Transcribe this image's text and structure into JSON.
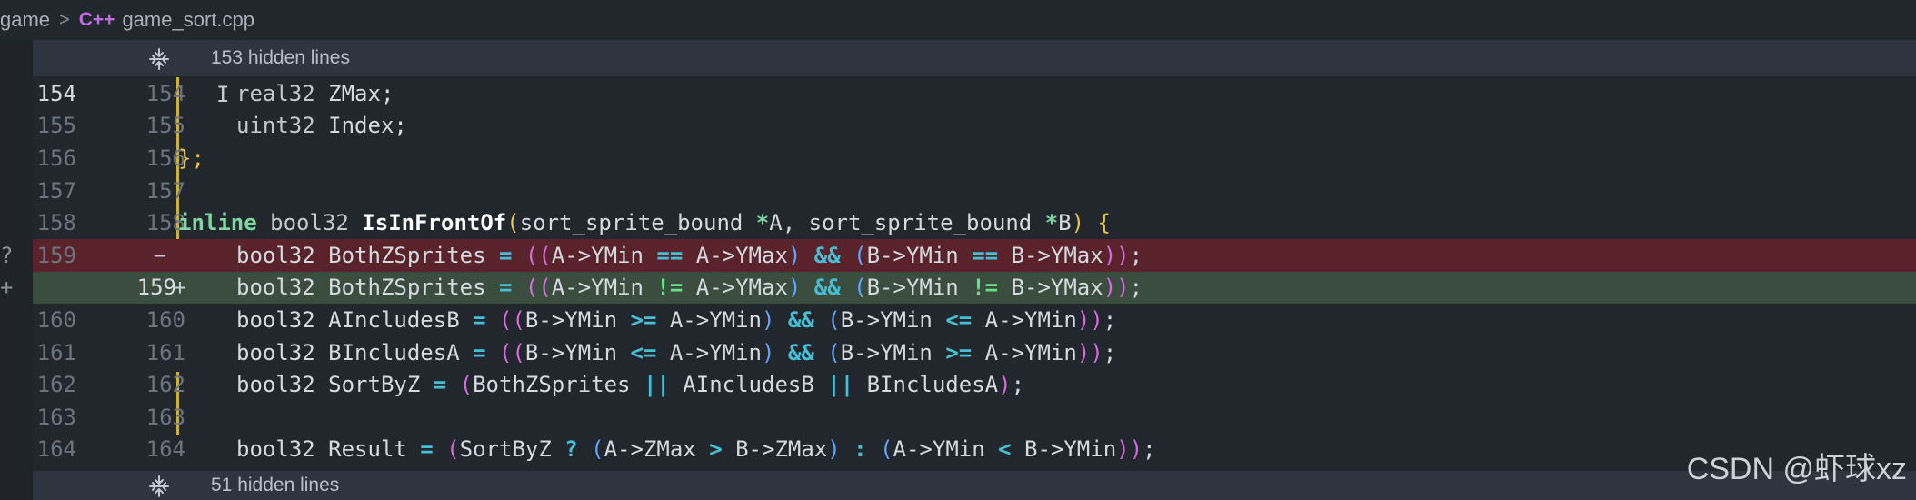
{
  "breadcrumb": {
    "folder": "game",
    "separator": ">",
    "file_icon": "C++",
    "file": "game_sort.cpp"
  },
  "top_fold": {
    "icon": "fold-icon",
    "label": "153 hidden lines"
  },
  "bottom_fold": {
    "icon": "fold-icon",
    "label": "51 hidden lines"
  },
  "lines": [
    {
      "old": "154",
      "new": "154",
      "marker": "",
      "kind": "normal"
    },
    {
      "old": "155",
      "new": "155",
      "marker": "",
      "kind": "normal"
    },
    {
      "old": "156",
      "new": "156",
      "marker": "",
      "kind": "normal"
    },
    {
      "old": "157",
      "new": "157",
      "marker": "",
      "kind": "normal"
    },
    {
      "old": "158",
      "new": "158",
      "marker": "",
      "kind": "normal"
    },
    {
      "old": "159",
      "new": "",
      "marker": "−",
      "kind": "removed"
    },
    {
      "old": "",
      "new": "159",
      "marker": "+",
      "kind": "added"
    },
    {
      "old": "160",
      "new": "160",
      "marker": "",
      "kind": "normal"
    },
    {
      "old": "161",
      "new": "161",
      "marker": "",
      "kind": "normal"
    },
    {
      "old": "162",
      "new": "162",
      "marker": "",
      "kind": "normal"
    },
    {
      "old": "163",
      "new": "163",
      "marker": "",
      "kind": "normal"
    },
    {
      "old": "164",
      "new": "164",
      "marker": "",
      "kind": "normal"
    }
  ],
  "code": {
    "l154": [
      "real32",
      " ZMax;"
    ],
    "l155": [
      "uint32",
      " Index;"
    ],
    "l156": [
      "};"
    ],
    "l158": [
      "inline",
      " bool32 ",
      "IsInFrontOf",
      "(",
      "sort_sprite_bound ",
      "*",
      "A, sort_sprite_bound ",
      "*",
      "B",
      ")",
      " {"
    ],
    "l159_old": [
      "bool32 BothZSprites ",
      "=",
      " ",
      "((",
      "A->YMin ",
      "==",
      " A->YMax",
      ")",
      " ",
      "&&",
      " ",
      "(",
      "B->YMin ",
      "==",
      " B->YMax",
      "))",
      ";"
    ],
    "l159_new": [
      "bool32 BothZSprites ",
      "=",
      " ",
      "((",
      "A->YMin ",
      "!=",
      " A->YMax",
      ")",
      " ",
      "&&",
      " ",
      "(",
      "B->YMin ",
      "!=",
      " B->YMax",
      "))",
      ";"
    ],
    "l160": [
      "bool32 AIncludesB ",
      "=",
      " ",
      "((",
      "B->YMin ",
      ">=",
      " A->YMin",
      ")",
      " ",
      "&&",
      " ",
      "(",
      "B->YMin ",
      "<=",
      " A->YMin",
      "))",
      ";"
    ],
    "l161": [
      "bool32 BIncludesA ",
      "=",
      " ",
      "((",
      "B->YMin ",
      "<=",
      " A->YMin",
      ")",
      " ",
      "&&",
      " ",
      "(",
      "B->YMin ",
      ">=",
      " A->YMin",
      "))",
      ";"
    ],
    "l162": [
      "bool32 SortByZ ",
      "=",
      " ",
      "(",
      "BothZSprites ",
      "||",
      " AIncludesB ",
      "||",
      " BIncludesA",
      ")",
      ";"
    ],
    "l164": [
      "bool32 Result ",
      "=",
      " ",
      "(",
      "SortByZ ",
      "?",
      " ",
      "(",
      "A->ZMax ",
      ">",
      " B->ZMax",
      ")",
      " ",
      ":",
      " ",
      "(",
      "A->YMin ",
      "<",
      " B->YMin",
      "))",
      ";"
    ]
  },
  "left_glyphs": {
    "row159": "?",
    "row160": "+"
  },
  "watermark": "CSDN @虾球xz",
  "colors": {
    "background": "#22262d",
    "removed_line": "#5a232b",
    "added_line": "#3a4d3e",
    "modified_bar": "#c9b13c"
  }
}
